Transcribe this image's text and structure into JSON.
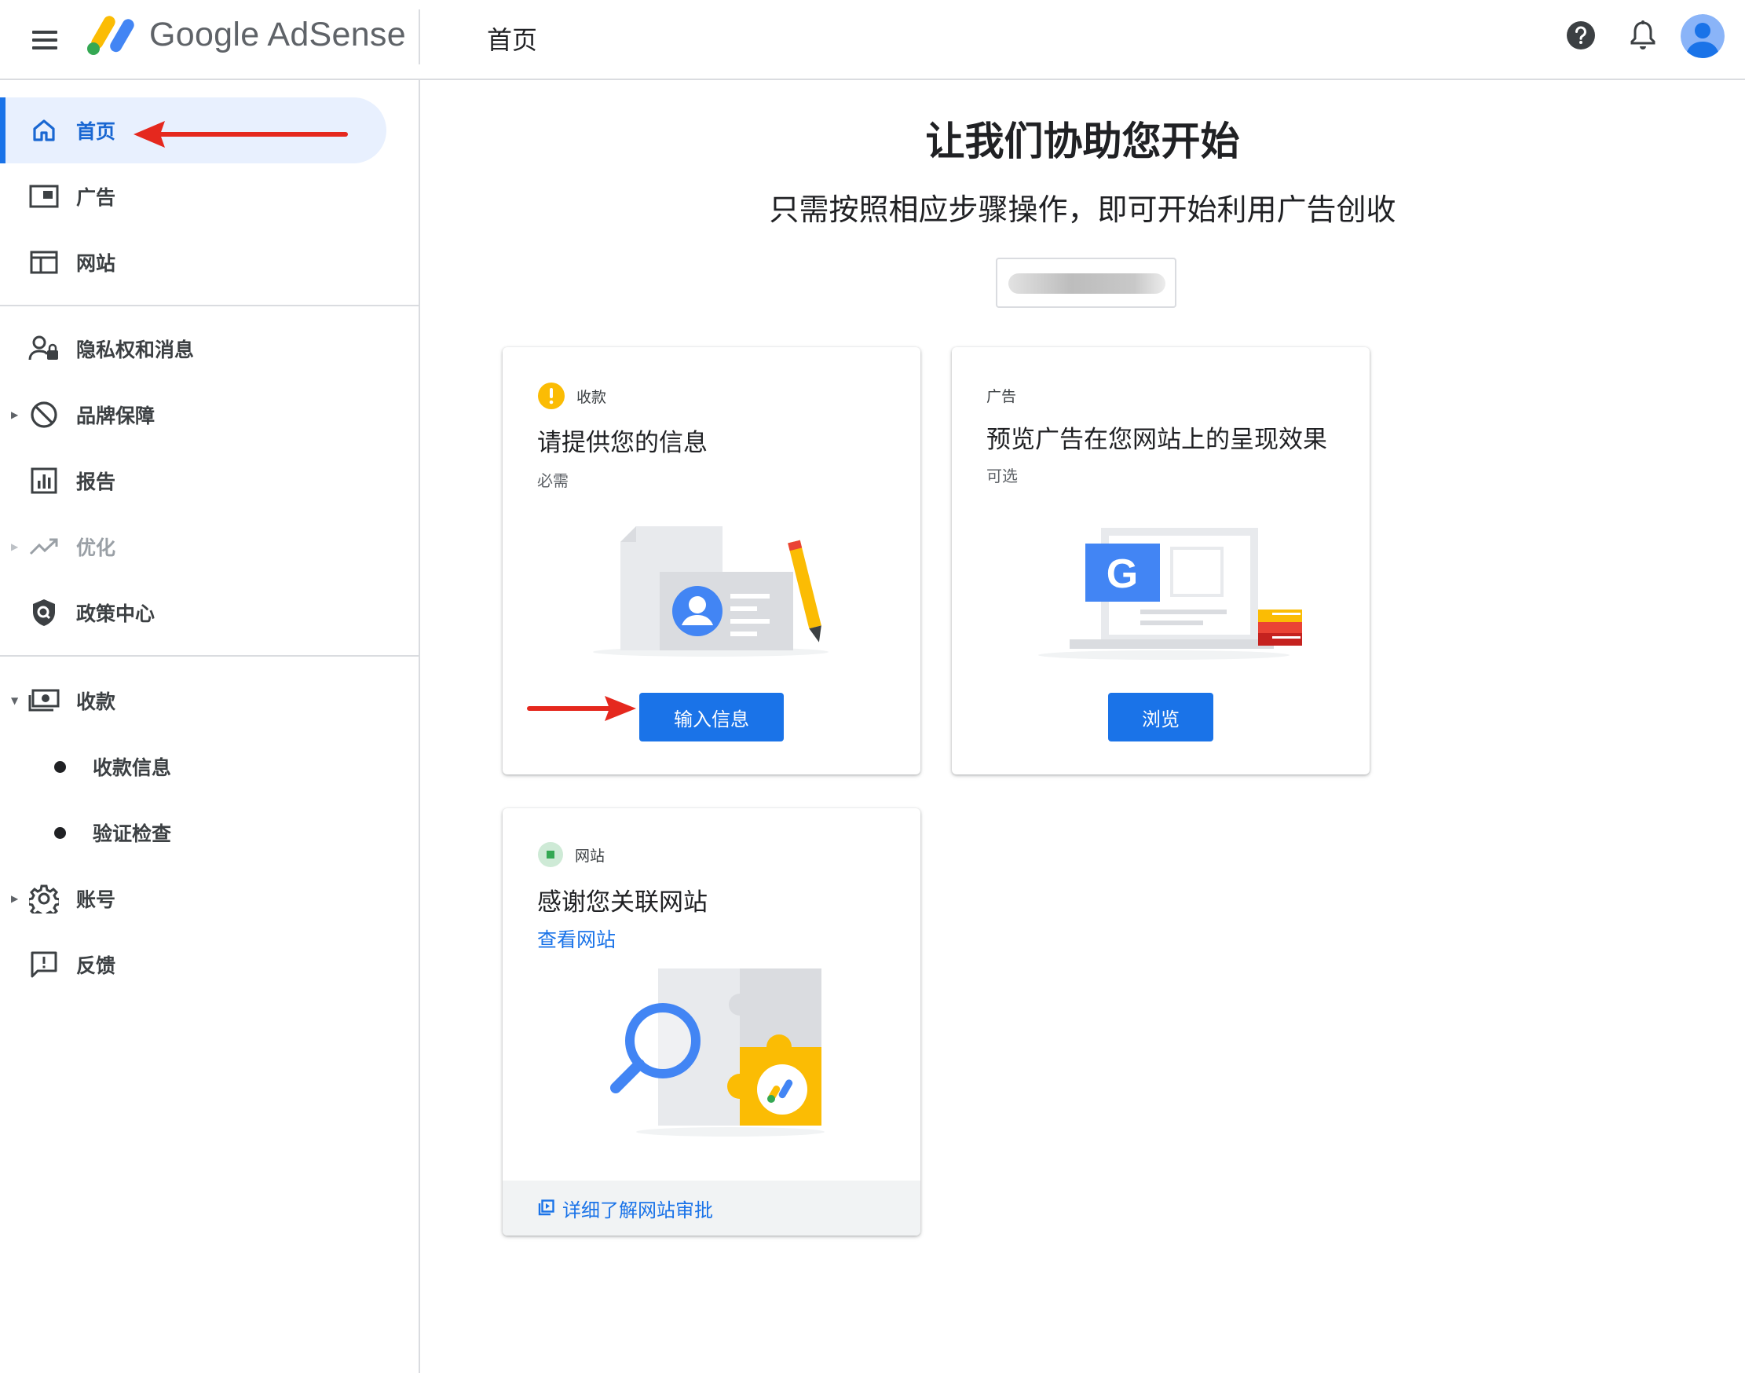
{
  "header": {
    "product_name": "Google AdSense",
    "page_title": "首页"
  },
  "sidebar": {
    "items": [
      {
        "label": "首页",
        "icon": "home-icon",
        "state": "active"
      },
      {
        "label": "广告",
        "icon": "ads-icon"
      },
      {
        "label": "网站",
        "icon": "sites-icon"
      },
      {
        "label": "隐私权和消息",
        "icon": "privacy-icon"
      },
      {
        "label": "品牌保障",
        "icon": "block-icon",
        "expandable": true
      },
      {
        "label": "报告",
        "icon": "report-icon"
      },
      {
        "label": "优化",
        "icon": "trending-icon",
        "expandable": true,
        "state": "disabled"
      },
      {
        "label": "政策中心",
        "icon": "policy-shield-icon"
      },
      {
        "label": "收款",
        "icon": "payments-icon",
        "expanded": true
      },
      {
        "label": "收款信息",
        "icon": "bullet-icon",
        "sub": true
      },
      {
        "label": "验证检查",
        "icon": "bullet-icon",
        "sub": true
      },
      {
        "label": "账号",
        "icon": "gear-icon",
        "expandable": true
      },
      {
        "label": "反馈",
        "icon": "feedback-icon"
      }
    ]
  },
  "main": {
    "headline": "让我们协助您开始",
    "subheadline": "只需按照相应步骤操作，即可开始利用广告创收"
  },
  "cards": {
    "payments": {
      "tag": "收款",
      "title": "请提供您的信息",
      "subtitle": "必需",
      "button": "输入信息"
    },
    "ads": {
      "tag": "广告",
      "title": "预览广告在您网站上的呈现效果",
      "subtitle": "可选",
      "button": "浏览"
    },
    "sites": {
      "tag": "网站",
      "title": "感谢您关联网站",
      "link": "查看网站",
      "footer_link": "详细了解网站审批"
    }
  },
  "colors": {
    "primary": "#1a73e8",
    "active_bg": "#e8f0fe",
    "warning": "#fbbc04",
    "success": "#34a853",
    "annotation_red": "#e5281e"
  }
}
